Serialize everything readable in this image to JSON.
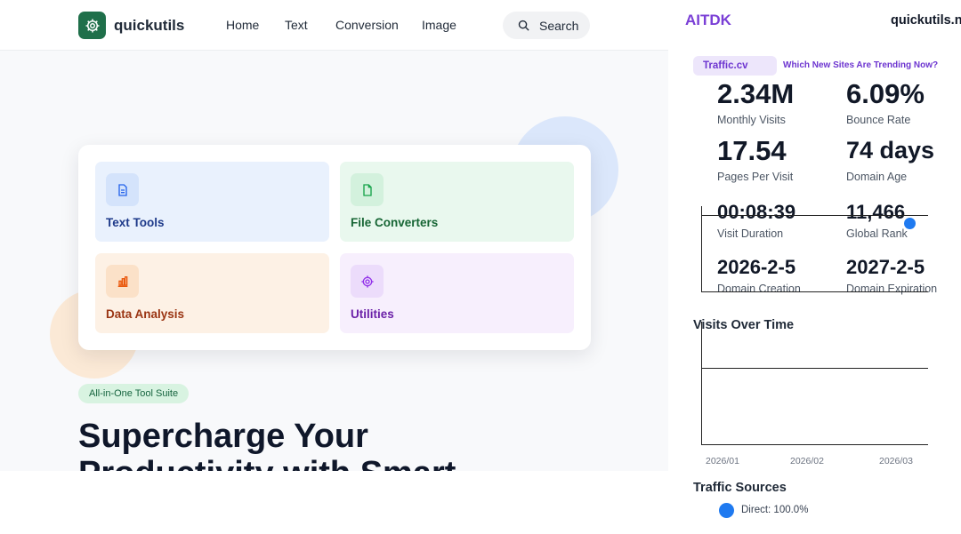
{
  "site": {
    "logo_text": "quickutils",
    "nav": [
      "Home",
      "Text",
      "Conversion",
      "Image"
    ],
    "search_label": "Search",
    "tiles": [
      {
        "label": "Text Tools",
        "icon": "document-icon",
        "color": "#1e3a8a"
      },
      {
        "label": "File Converters",
        "icon": "file-icon",
        "color": "#166534"
      },
      {
        "label": "Data Analysis",
        "icon": "bar-chart-icon",
        "color": "#9a3412"
      },
      {
        "label": "Utilities",
        "icon": "gear-icon",
        "color": "#6b21a8"
      }
    ],
    "badge": "All-in-One Tool Suite",
    "headline_line1": "Supercharge Your",
    "headline_line2": "Productivity with Smart"
  },
  "panel": {
    "brand": "AITDK",
    "domain": "quickutils.n",
    "source_tag": "Traffic.cv",
    "trend_link": "Which New Sites Are Trending Now?",
    "stats": [
      {
        "value": "2.34M",
        "label": "Monthly Visits"
      },
      {
        "value": "6.09%",
        "label": "Bounce Rate"
      },
      {
        "value": "17.54",
        "label": "Pages Per Visit"
      },
      {
        "value": "74 days",
        "label": "Domain Age"
      },
      {
        "value": "00:08:39",
        "label": "Visit Duration"
      },
      {
        "value": "11,466",
        "label": "Global Rank"
      },
      {
        "value": "2026-2-5",
        "label": "Domain Creation"
      },
      {
        "value": "2027-2-5",
        "label": "Domain Expiration"
      }
    ],
    "visits_title": "Visits Over Time",
    "x_ticks": [
      "2026/01",
      "2026/02",
      "2026/03"
    ],
    "sources_title": "Traffic Sources",
    "sources_legend": "Direct: 100.0%",
    "accent": "#1f7af0"
  }
}
